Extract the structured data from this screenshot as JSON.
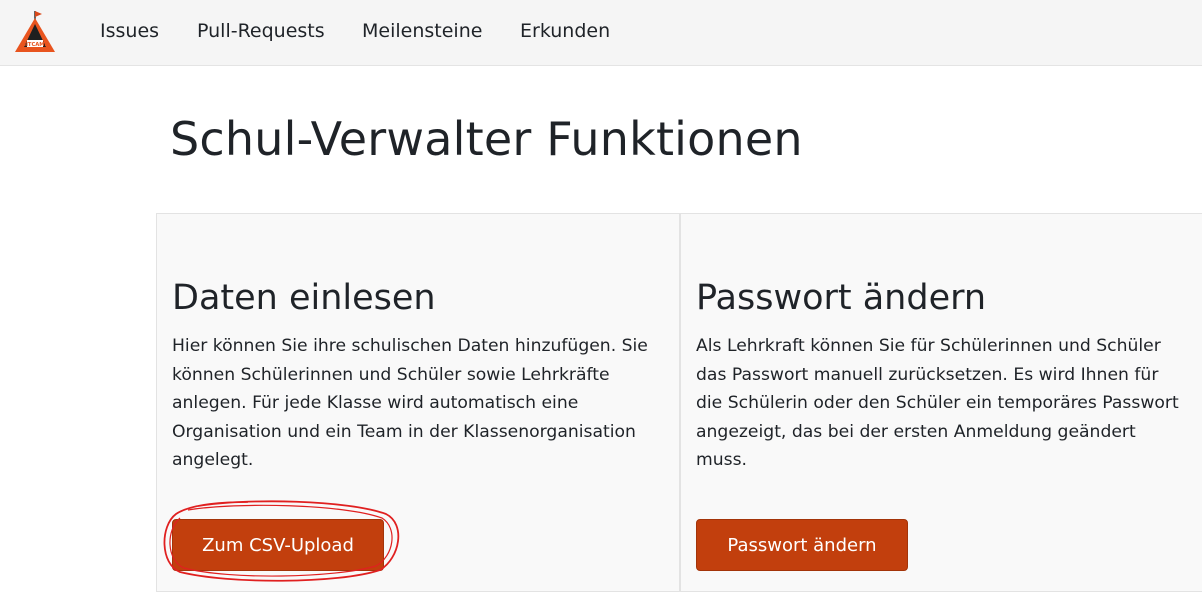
{
  "logo": {
    "text": "GITCAMP"
  },
  "nav": {
    "items": [
      {
        "label": "Issues"
      },
      {
        "label": "Pull-Requests"
      },
      {
        "label": "Meilensteine"
      },
      {
        "label": "Erkunden"
      }
    ]
  },
  "page": {
    "title": "Schul-Verwalter Funktionen"
  },
  "cards": [
    {
      "title": "Daten einlesen",
      "lines": [
        "Hier können Sie ihre schulischen Daten hinzufügen. Sie",
        "können Schülerinnen und Schüler sowie Lehrkräfte",
        "anlegen. Für jede Klasse wird automatisch eine",
        "Organisation und ein Team in der Klassenorganisation",
        "angelegt."
      ],
      "button": "Zum CSV-Upload"
    },
    {
      "title": "Passwort ändern",
      "lines": [
        "Als Lehrkraft können Sie für Schülerinnen und Schüler",
        "das Passwort manuell zurücksetzen. Es wird Ihnen für",
        "die Schülerin oder den Schüler ein temporäres Passwort",
        "angezeigt, das bei der ersten Anmeldung geändert",
        "muss."
      ],
      "button": "Passwort ändern"
    }
  ],
  "colors": {
    "accent": "#c23f0d",
    "highlight_circle": "#e02020",
    "topbar_bg": "#f5f5f5",
    "card_bg": "#f9f9f9"
  },
  "icons": {
    "logo": "gitcamp-tent-logo-icon"
  }
}
